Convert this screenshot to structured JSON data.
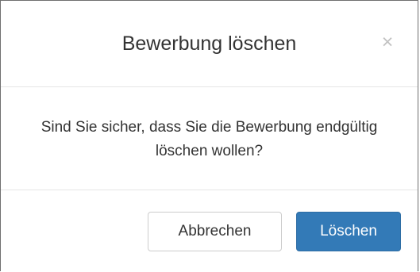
{
  "dialog": {
    "title": "Bewerbung löschen",
    "close_symbol": "×",
    "message": "Sind Sie sicher, dass Sie die Bewerbung endgültig löschen wollen?",
    "cancel_label": "Abbrechen",
    "confirm_label": "Löschen"
  },
  "colors": {
    "primary": "#337ab7",
    "text": "#333333",
    "divider": "#e5e5e5"
  }
}
